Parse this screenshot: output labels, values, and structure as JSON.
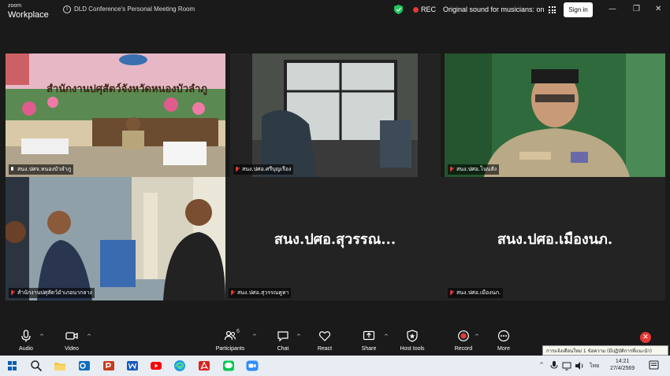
{
  "titlebar": {
    "brand_top": "zoom",
    "brand_bottom": "Workplace",
    "info_glyph": "i",
    "meeting_title": "DLD Conference's Personal Meeting Room",
    "rec_label": "REC",
    "original_sound": "Original sound for musicians: on",
    "sign_in": "Sign in",
    "minimize": "—",
    "maximize": "❐",
    "close": "✕"
  },
  "participants": [
    {
      "label": "สนง.ปศจ.หนองบัวลำภู",
      "muted": false,
      "active": true
    },
    {
      "label": "สนง.ปศอ.ศรีบุญเรือง",
      "muted": true,
      "active": false
    },
    {
      "label": "สนง.ปศอ.โนนสัง",
      "muted": true,
      "active": false
    },
    {
      "label": "สำนักงานปศุสัตว์อำเภอนากลาง",
      "muted": true,
      "active": false
    },
    {
      "label": "สนง.ปศอ.สุวรรณคูหา",
      "muted": true,
      "active": false,
      "big_name": "สนง.ปศอ.สุวรรณ..."
    },
    {
      "label": "สนง.ปศอ.เมืองนภ.",
      "muted": true,
      "active": false,
      "big_name": "สนง.ปศอ.เมืองนภ."
    }
  ],
  "banner_text": "สำนักงานปศุสัตว์จังหวัดหนองบัวลำภู",
  "toolbar": {
    "audio": "Audio",
    "video": "Video",
    "participants": "Participants",
    "participants_count": "6",
    "chat": "Chat",
    "react": "React",
    "share": "Share",
    "host_tools": "Host tools",
    "record": "Record",
    "more": "More",
    "caret": "^",
    "end_glyph": "✕"
  },
  "tooltip": "การแจ้งเตือนใหม่ 1 ข้อความ (มีปฏิบัติการที่แนะนำ)",
  "taskbar": {
    "tray_caret": "^",
    "language": "ไทย",
    "time": "14:21",
    "date": "27/4/2569"
  },
  "colors": {
    "active_border": "#2ecc71",
    "rec_red": "#e53935",
    "background": "#1a1a1a"
  }
}
